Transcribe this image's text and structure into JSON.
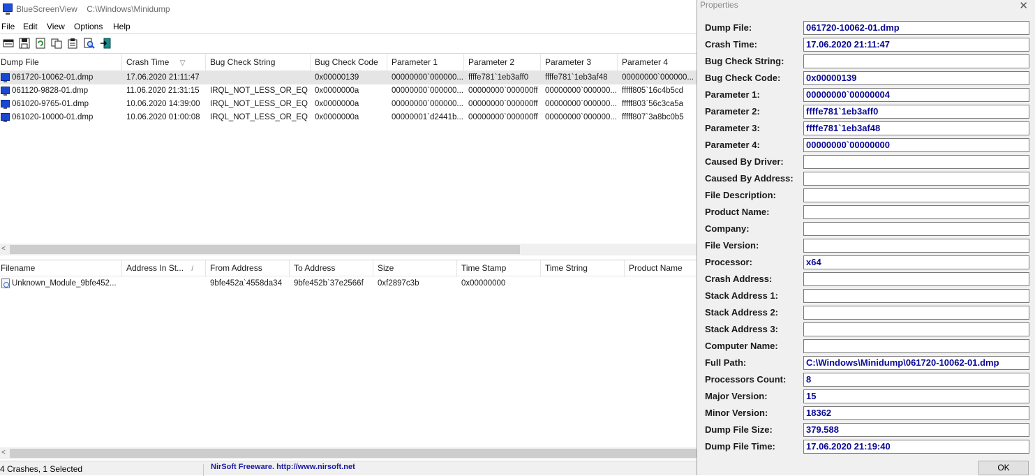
{
  "window": {
    "app_name": "BlueScreenView",
    "path": "C:\\Windows\\Minidump"
  },
  "menu": [
    "File",
    "Edit",
    "View",
    "Options",
    "Help"
  ],
  "toolbar": [
    "html-report-icon",
    "save-icon",
    "refresh-icon",
    "copy-icon",
    "properties-icon",
    "find-icon",
    "exit-icon"
  ],
  "crash_list": {
    "columns": [
      "Dump File",
      "Crash Time",
      "Bug Check String",
      "Bug Check Code",
      "Parameter 1",
      "Parameter 2",
      "Parameter 3",
      "Parameter 4"
    ],
    "sort_indicator": "▽",
    "rows": [
      [
        "061720-10062-01.dmp",
        "17.06.2020 21:11:47",
        "",
        "0x00000139",
        "00000000`000000...",
        "ffffe781`1eb3aff0",
        "ffffe781`1eb3af48",
        "00000000`000000..."
      ],
      [
        "061120-9828-01.dmp",
        "11.06.2020 21:31:15",
        "IRQL_NOT_LESS_OR_EQ...",
        "0x0000000a",
        "00000000`000000...",
        "00000000`000000ff",
        "00000000`000000...",
        "fffff805`16c4b5cd"
      ],
      [
        "061020-9765-01.dmp",
        "10.06.2020 14:39:00",
        "IRQL_NOT_LESS_OR_EQ...",
        "0x0000000a",
        "00000000`000000...",
        "00000000`000000ff",
        "00000000`000000...",
        "fffff803`56c3ca5a"
      ],
      [
        "061020-10000-01.dmp",
        "10.06.2020 01:00:08",
        "IRQL_NOT_LESS_OR_EQ...",
        "0x0000000a",
        "00000001`d2441b...",
        "00000000`000000ff",
        "00000000`000000...",
        "fffff807`3a8bc0b5"
      ]
    ]
  },
  "module_list": {
    "columns": [
      "Filename",
      "Address In St...",
      "From Address",
      "To Address",
      "Size",
      "Time Stamp",
      "Time String",
      "Product Name"
    ],
    "sort_indicator": "/",
    "rows": [
      [
        "Unknown_Module_9bfe452...",
        "",
        "9bfe452a`4558da34",
        "9bfe452b`37e2566f",
        "0xf2897c3b",
        "0x00000000",
        "",
        ""
      ]
    ]
  },
  "status": {
    "left": "4 Crashes, 1 Selected",
    "right": "NirSoft Freeware.  http://www.nirsoft.net"
  },
  "properties": {
    "title": "Properties",
    "close": "✕",
    "fields": [
      {
        "label": "Dump File:",
        "value": "061720-10062-01.dmp"
      },
      {
        "label": "Crash Time:",
        "value": "17.06.2020 21:11:47"
      },
      {
        "label": "Bug Check String:",
        "value": ""
      },
      {
        "label": "Bug Check Code:",
        "value": "0x00000139"
      },
      {
        "label": "Parameter 1:",
        "value": "00000000`00000004"
      },
      {
        "label": "Parameter 2:",
        "value": "ffffe781`1eb3aff0"
      },
      {
        "label": "Parameter 3:",
        "value": "ffffe781`1eb3af48"
      },
      {
        "label": "Parameter 4:",
        "value": "00000000`00000000"
      },
      {
        "label": "Caused By Driver:",
        "value": ""
      },
      {
        "label": "Caused By Address:",
        "value": ""
      },
      {
        "label": "File Description:",
        "value": ""
      },
      {
        "label": "Product Name:",
        "value": ""
      },
      {
        "label": "Company:",
        "value": ""
      },
      {
        "label": "File Version:",
        "value": ""
      },
      {
        "label": "Processor:",
        "value": "x64"
      },
      {
        "label": "Crash Address:",
        "value": ""
      },
      {
        "label": "Stack Address 1:",
        "value": ""
      },
      {
        "label": "Stack Address 2:",
        "value": ""
      },
      {
        "label": "Stack Address 3:",
        "value": ""
      },
      {
        "label": "Computer Name:",
        "value": ""
      },
      {
        "label": "Full Path:",
        "value": "C:\\Windows\\Minidump\\061720-10062-01.dmp"
      },
      {
        "label": "Processors Count:",
        "value": "8"
      },
      {
        "label": "Major Version:",
        "value": "15"
      },
      {
        "label": "Minor Version:",
        "value": "18362"
      },
      {
        "label": "Dump File Size:",
        "value": "379.588"
      },
      {
        "label": "Dump File Time:",
        "value": "17.06.2020 21:19:40"
      }
    ],
    "ok_label": "OK"
  },
  "colors": {
    "field_text": "#0a0a96",
    "status_link": "#1a1aa6",
    "selection": "#e5e5e5"
  }
}
